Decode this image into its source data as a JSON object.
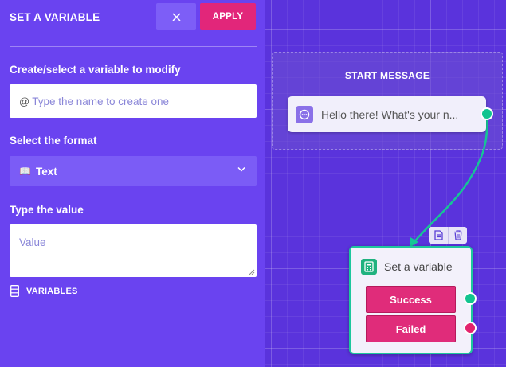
{
  "panel": {
    "title": "SET A VARIABLE",
    "apply_label": "APPLY",
    "variable_label": "Create/select a variable to modify",
    "variable_prefix": "@",
    "variable_placeholder": "Type the name to create one",
    "format_label": "Select the format",
    "format_value": "Text",
    "value_label": "Type the value",
    "value_placeholder": "Value",
    "variables_link": "VARIABLES"
  },
  "canvas": {
    "start_group_title": "START MESSAGE",
    "start_message_text": "Hello there! What's your n...",
    "node_title": "Set a variable",
    "outcomes": [
      {
        "label": "Success",
        "color": "#12c48f"
      },
      {
        "label": "Failed",
        "color": "#e3246d"
      }
    ]
  },
  "icons": {
    "close": "close-icon",
    "format": "book-icon",
    "dropdown": "chevron-down-icon",
    "variables": "variables-icon",
    "start_message": "chat-bubble-icon",
    "set_variable": "calculator-icon",
    "duplicate": "duplicate-icon",
    "delete": "trash-icon"
  },
  "colors": {
    "panel_bg": "#6a43f0",
    "apply_bg": "#e2267a",
    "accent_green": "#12c48f",
    "outcome_bg": "#e02c7a"
  }
}
